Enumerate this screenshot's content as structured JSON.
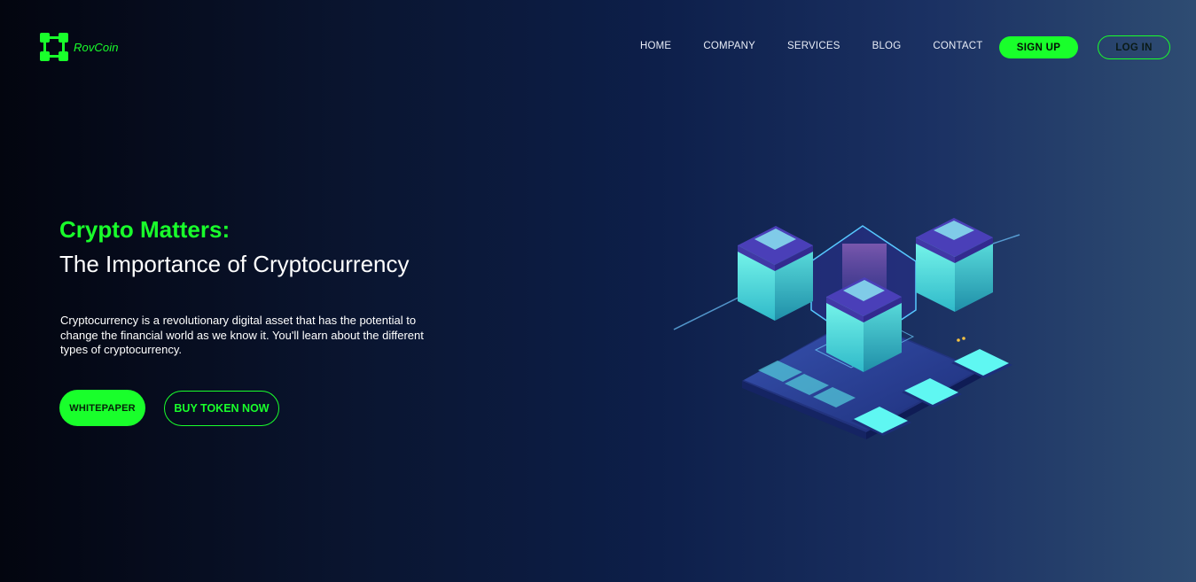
{
  "brand": {
    "name": "RovCoin",
    "logo_icon": "blockchain-nodes-icon",
    "accent_color": "#19ff2b"
  },
  "nav": {
    "items": [
      {
        "label": "HOME"
      },
      {
        "label": "COMPANY"
      },
      {
        "label": "SERVICES"
      },
      {
        "label": "BLOG"
      },
      {
        "label": "CONTACT"
      }
    ],
    "signup_label": "SIGN UP",
    "login_label": "LOG IN"
  },
  "hero": {
    "title": "Crypto Matters:",
    "subtitle": "The Importance of Cryptocurrency",
    "description": "Cryptocurrency is a revolutionary digital asset that has the potential to change the financial world as we know it. You'll learn about the different types of cryptocurrency.",
    "primary_button": "WHITEPAPER",
    "secondary_button": "BUY TOKEN NOW",
    "illustration": "isometric-blockchain-servers-illustration"
  }
}
